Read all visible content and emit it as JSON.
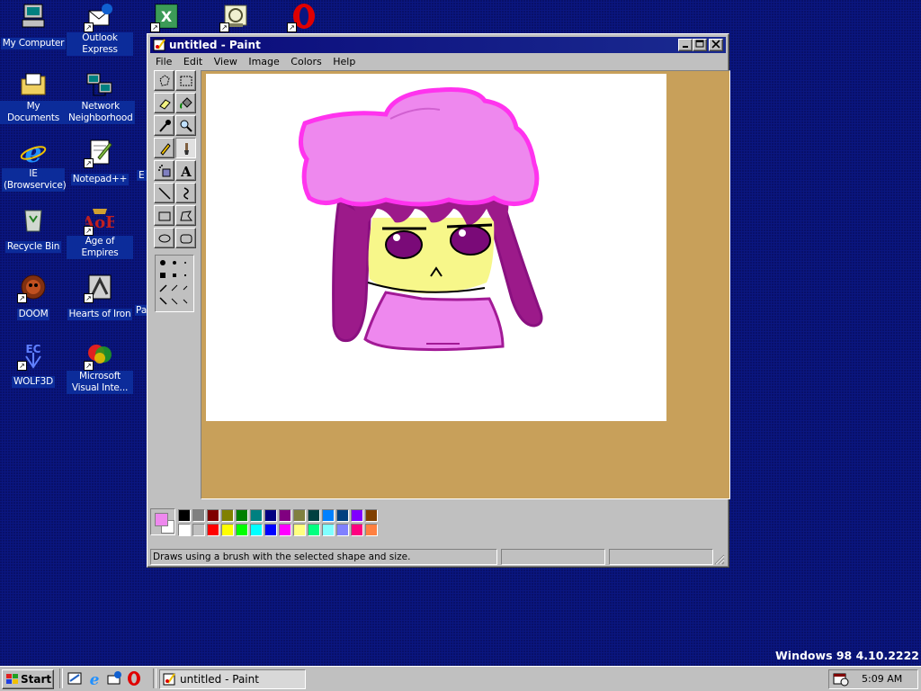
{
  "desktop": {
    "icons": [
      {
        "label": "My Computer",
        "icon": "my-computer-icon"
      },
      {
        "label": "Outlook Express",
        "icon": "outlook-express-icon"
      },
      {
        "label": "",
        "icon": "excel-icon"
      },
      {
        "label": "",
        "icon": "chart-app-icon"
      },
      {
        "label": "",
        "icon": "opera-icon"
      },
      {
        "label": "My Documents",
        "icon": "my-documents-icon"
      },
      {
        "label": "Network Neighborhood",
        "icon": "network-neighborhood-icon"
      },
      {
        "label": "IE (Browservice)",
        "icon": "internet-explorer-icon"
      },
      {
        "label": "Notepad++",
        "icon": "notepad-plus-plus-icon"
      },
      {
        "label": "Recycle Bin",
        "icon": "recycle-bin-icon"
      },
      {
        "label": "Age of Empires",
        "icon": "age-of-empires-icon"
      },
      {
        "label": "DOOM",
        "icon": "doom-icon"
      },
      {
        "label": "Hearts of Iron",
        "icon": "hearts-of-iron-icon"
      },
      {
        "label": "WOLF3D",
        "icon": "wolf3d-icon"
      },
      {
        "label": "Microsoft Visual Inte...",
        "icon": "visual-interdev-icon"
      }
    ],
    "partial_labels": [
      "E",
      "Pa"
    ]
  },
  "window": {
    "title": "untitled - Paint",
    "menu": [
      "File",
      "Edit",
      "View",
      "Image",
      "Colors",
      "Help"
    ],
    "status": "Draws using a brush with the selected shape and size."
  },
  "tools": [
    "free-form-select",
    "select",
    "eraser",
    "fill",
    "pick-color",
    "magnifier",
    "pencil",
    "brush",
    "airbrush",
    "text",
    "line",
    "curve",
    "rectangle",
    "polygon",
    "ellipse",
    "rounded-rectangle"
  ],
  "palette": {
    "foreground": "#ee88ee",
    "background": "#ffffff",
    "row1": [
      "#000000",
      "#808080",
      "#800000",
      "#808000",
      "#008000",
      "#008080",
      "#000080",
      "#800080",
      "#808040",
      "#004040",
      "#0080ff",
      "#004080",
      "#8000ff",
      "#804000"
    ],
    "row2": [
      "#ffffff",
      "#c0c0c0",
      "#ff0000",
      "#ffff00",
      "#00ff00",
      "#00ffff",
      "#0000ff",
      "#ff00ff",
      "#ffff80",
      "#00ff80",
      "#80ffff",
      "#8080ff",
      "#ff0080",
      "#ff8040"
    ]
  },
  "taskbar": {
    "start_label": "Start",
    "task_label": "untitled - Paint",
    "clock": "5:09 AM"
  },
  "version_text": "Windows 98 4.10.2222"
}
